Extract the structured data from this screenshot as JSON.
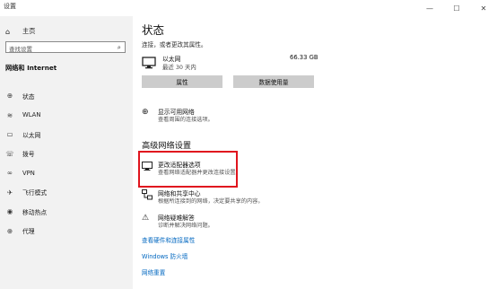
{
  "window": {
    "title": "设置",
    "minimize_icon": "minimize-icon",
    "maximize_icon": "maximize-icon",
    "close_icon": "close-icon"
  },
  "sidebar": {
    "home_label": "主页",
    "search_placeholder": "查找设置",
    "section_title": "网络和 Internet",
    "items": [
      {
        "label": "状态",
        "icon": "globe-icon"
      },
      {
        "label": "WLAN",
        "icon": "wifi-icon"
      },
      {
        "label": "以太网",
        "icon": "ethernet-icon"
      },
      {
        "label": "拨号",
        "icon": "phone-icon"
      },
      {
        "label": "VPN",
        "icon": "vpn-icon"
      },
      {
        "label": "飞行模式",
        "icon": "airplane-icon"
      },
      {
        "label": "移动热点",
        "icon": "hotspot-icon"
      },
      {
        "label": "代理",
        "icon": "globe-icon"
      }
    ]
  },
  "main": {
    "title": "状态",
    "subtitle": "连接，或者更改其属性。",
    "ethernet": {
      "name": "以太网",
      "status": "最近 30 天内",
      "data_used": "66.33 GB"
    },
    "buttons": {
      "properties": "属性",
      "data_usage": "数据使用量"
    },
    "show_networks": {
      "title": "显示可用网络",
      "desc": "查看周围的连接选项。"
    },
    "advanced_title": "高级网络设置",
    "adapter": {
      "title": "更改适配器选项",
      "desc": "查看网络适配器并更改连接设置。"
    },
    "sharing": {
      "title": "网络和共享中心",
      "desc": "根据所连接到的网络，决定要共享的内容。"
    },
    "troubleshoot": {
      "title": "网络疑难解答",
      "desc": "诊断并解决网络问题。"
    },
    "links": {
      "hardware": "查看硬件和连接属性",
      "firewall": "Windows 防火墙",
      "reset": "网络重置"
    }
  },
  "colors": {
    "sidebar_bg": "#f2f2f2",
    "button_bg": "#cccccc",
    "link": "#0067c0",
    "highlight": "#e0141e"
  }
}
